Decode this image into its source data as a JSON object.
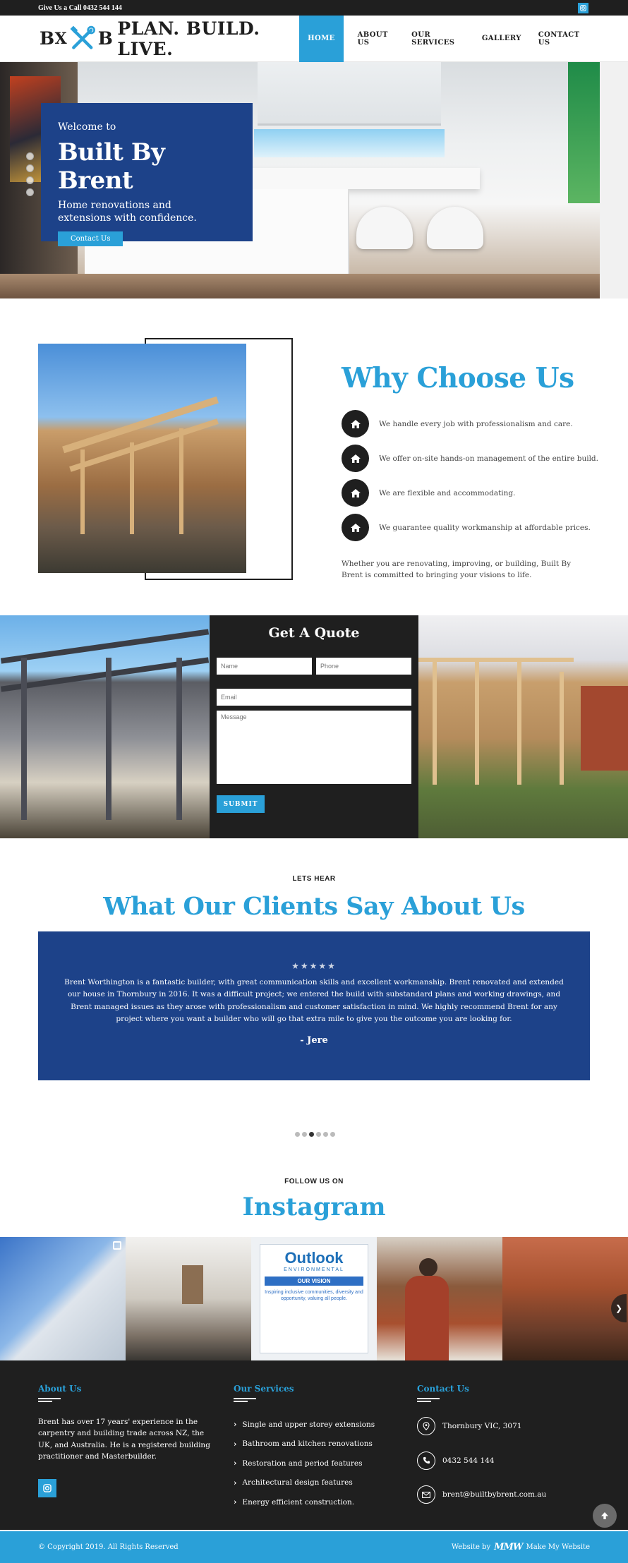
{
  "topbar": {
    "call_text": "Give Us a Call 0432 544 144",
    "instagram_icon": "instagram-icon"
  },
  "brand": {
    "logo_left": "B",
    "logo_x": "X",
    "logo_right": "B",
    "tagline": "PLAN. BUILD. LIVE."
  },
  "nav": {
    "items": [
      "HOME",
      "ABOUT US",
      "OUR SERVICES",
      "GALLERY",
      "CONTACT US"
    ],
    "active": "HOME"
  },
  "hero": {
    "welcome": "Welcome to",
    "title": "Built By Brent",
    "subtitle": "Home renovations and extensions with confidence.",
    "cta": "Contact Us"
  },
  "why": {
    "heading": "Why Choose Us",
    "items": [
      "We handle every job with professionalism and care.",
      "We offer on-site hands-on management of the entire build.",
      "We are flexible and accommodating.",
      "We guarantee quality workmanship at affordable prices."
    ],
    "item_icon": "home-icon",
    "paragraph": "Whether you are renovating, improving, or building, Built By Brent is committed to bringing your visions to life."
  },
  "quote": {
    "heading": "Get A Quote",
    "name_placeholder": "Name",
    "phone_placeholder": "Phone",
    "email_placeholder": "Email",
    "message_placeholder": "Message",
    "submit": "SUBMIT"
  },
  "clients": {
    "eyebrow": "LETS HEAR",
    "heading": "What Our Clients Say About Us",
    "stars": "★★★★★",
    "text": "Brent Worthington is a fantastic builder, with great communication skills and excellent workmanship. Brent renovated and extended our house in Thornbury in 2016. It was a difficult project; we entered the build with substandard plans and working drawings, and Brent managed issues as they arose with professionalism and customer satisfaction in mind. We highly recommend Brent for any project where you want a builder who will go that extra mile to give you the outcome you are looking for.",
    "author": "- Jere"
  },
  "instagram": {
    "eyebrow": "FOLLOW US ON",
    "heading": "Instagram",
    "sign_title": "Outlook",
    "sign_sub": "ENVIRONMENTAL",
    "sign_line": "Inspiring inclusive communities, diversity and opportunity, valuing all people.",
    "sign_vision": "OUR VISION"
  },
  "footer": {
    "about_title": "About Us",
    "about_text": "Brent has over 17 years' experience in the carpentry and building trade across NZ, the UK, and Australia. He is a registered building practitioner and Masterbuilder.",
    "services_title": "Our Services",
    "services": [
      "Single and upper storey extensions",
      "Bathroom and kitchen renovations",
      "Restoration and period features",
      "Architectural design features",
      "Energy efficient construction."
    ],
    "contact_title": "Contact Us",
    "contact": {
      "address": "Thornbury VIC, 3071",
      "phone": "0432 544 144",
      "email": "brent@builtbybrent.com.au"
    }
  },
  "bottom": {
    "copyright": "© Copyright 2019. All Rights Reserved",
    "credit_prefix": "Website by",
    "credit_logo": "MMW",
    "credit_suffix": "Make My Website"
  },
  "colors": {
    "accent": "#2aa0d8",
    "navy": "#1d4289",
    "dark": "#1f1f1f"
  }
}
